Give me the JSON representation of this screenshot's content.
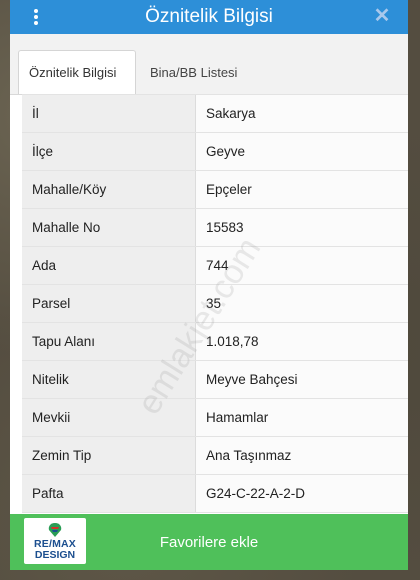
{
  "window": {
    "title": "Öznitelik Bilgisi"
  },
  "tabs": [
    {
      "label": "Öznitelik Bilgisi",
      "active": true
    },
    {
      "label": "Bina/BB Listesi",
      "active": false
    }
  ],
  "attributes": [
    {
      "key": "İl",
      "value": "Sakarya"
    },
    {
      "key": "İlçe",
      "value": "Geyve"
    },
    {
      "key": "Mahalle/Köy",
      "value": "Epçeler"
    },
    {
      "key": "Mahalle No",
      "value": "15583"
    },
    {
      "key": "Ada",
      "value": "744"
    },
    {
      "key": "Parsel",
      "value": "35"
    },
    {
      "key": "Tapu Alanı",
      "value": "1.018,78"
    },
    {
      "key": "Nitelik",
      "value": "Meyve Bahçesi"
    },
    {
      "key": "Mevkii",
      "value": "Hamamlar"
    },
    {
      "key": "Zemin Tip",
      "value": "Ana Taşınmaz"
    },
    {
      "key": "Pafta",
      "value": "G24-C-22-A-2-D"
    }
  ],
  "footer": {
    "button_label": "Favorilere ekle"
  },
  "logo": {
    "line1": "RE/MAX",
    "line2": "DESIGN"
  },
  "watermark": "emlakjet.com",
  "colors": {
    "titlebar": "#2d8fd8",
    "favorite_button": "#4fc05a",
    "logo_text": "#1b4e8f"
  },
  "icons": {
    "menu": "vertical-dots-icon",
    "close": "close-icon"
  }
}
